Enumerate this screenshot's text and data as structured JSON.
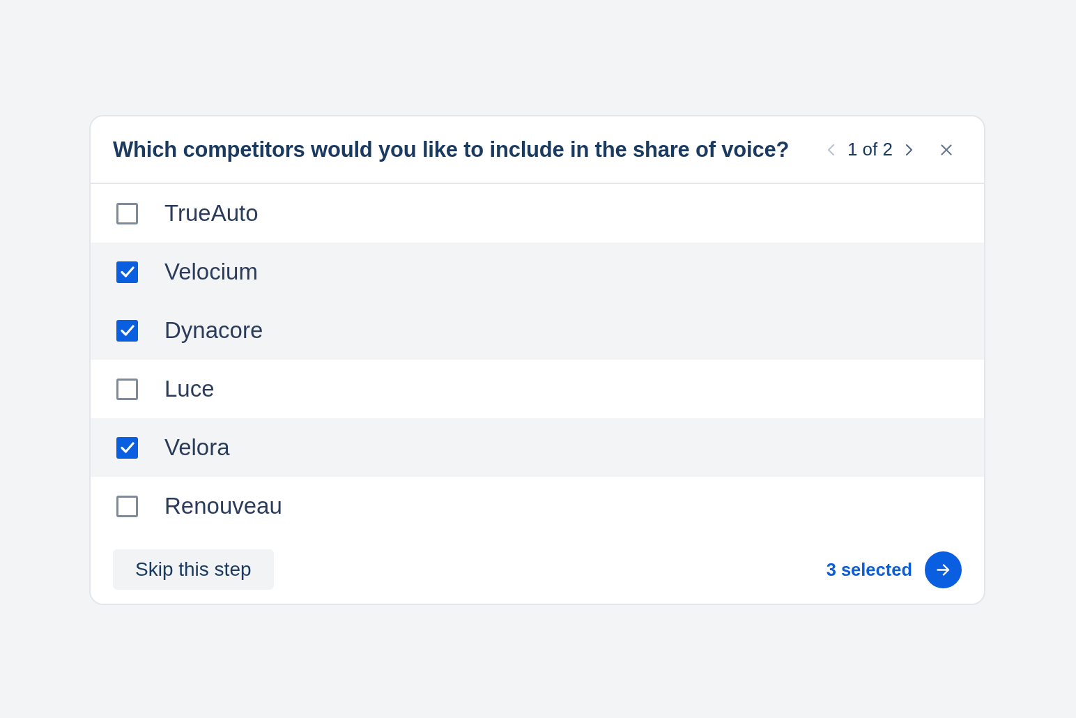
{
  "dialog": {
    "title": "Which competitors would you like to include in the share of voice?",
    "pagination": {
      "previous": {
        "disabled": true
      },
      "label": "1 of 2",
      "next": {
        "disabled": false
      }
    },
    "options": [
      {
        "label": "TrueAuto",
        "checked": false
      },
      {
        "label": "Velocium",
        "checked": true
      },
      {
        "label": "Dynacore",
        "checked": true
      },
      {
        "label": "Luce",
        "checked": false
      },
      {
        "label": "Velora",
        "checked": true
      },
      {
        "label": "Renouveau",
        "checked": false
      }
    ],
    "footer": {
      "skip_button": "Skip this step",
      "selected_count": "3 selected"
    }
  }
}
